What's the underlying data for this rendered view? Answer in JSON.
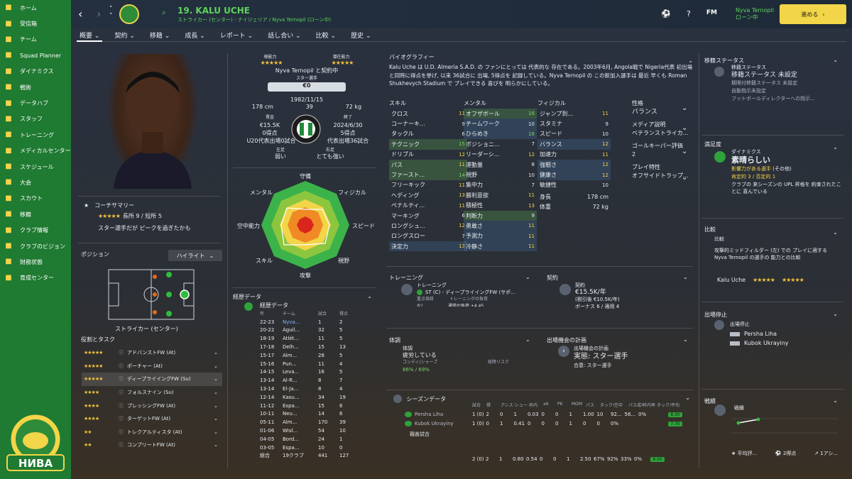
{
  "sidebar": {
    "items": [
      {
        "label": "ホーム",
        "icon": "home-icon"
      },
      {
        "label": "受信箱",
        "icon": "inbox-icon"
      },
      {
        "label": "チーム",
        "icon": "team-icon"
      },
      {
        "label": "Squad Planner",
        "icon": "planner-icon"
      },
      {
        "label": "ダイナミクス",
        "icon": "dynamics-icon"
      },
      {
        "label": "戦術",
        "icon": "tactics-icon"
      },
      {
        "label": "データハブ",
        "icon": "datahub-icon"
      },
      {
        "label": "スタッフ",
        "icon": "staff-icon"
      },
      {
        "label": "トレーニング",
        "icon": "training-icon"
      },
      {
        "label": "メディカルセンター",
        "icon": "medical-icon"
      },
      {
        "label": "スケジュール",
        "icon": "calendar-icon"
      },
      {
        "label": "大会",
        "icon": "trophy-icon"
      },
      {
        "label": "スカウト",
        "icon": "scout-icon"
      },
      {
        "label": "移籍",
        "icon": "transfer-icon"
      },
      {
        "label": "クラブ情報",
        "icon": "club-info-icon"
      },
      {
        "label": "クラブのビジョン",
        "icon": "vision-icon"
      },
      {
        "label": "財務状態",
        "icon": "finance-icon"
      },
      {
        "label": "育成センター",
        "icon": "development-icon"
      }
    ],
    "logo_text": "НИВА"
  },
  "topbar": {
    "player_name": "19. KALU UCHE",
    "subtitle": "ストライカー (センター) - ナイジェリア / Nyva Ternopil (ローン中)",
    "status_line1": "Nyva Ternopil",
    "status_line2": "ローン中",
    "fm_label": "FM",
    "continue_label": "進める"
  },
  "tabs": [
    "概要",
    "契約",
    "移籍",
    "成長",
    "レポート",
    "話し合い",
    "比較",
    "歴史"
  ],
  "overview": {
    "current_ability_label": "現能力",
    "potential_ability_label": "潜在能力",
    "contract_club": "Nyva Ternopil と契約中",
    "star_player": "スター選手",
    "value": "€0",
    "dob": "1982/11/15",
    "height": "178 cm",
    "age": "39",
    "weight": "72 kg",
    "wage_label": "賃金",
    "wage": "€15.5K",
    "expiry_label": "終了",
    "expiry": "2024/6/30",
    "goals_left": "0得点",
    "goals_right": "5得点",
    "u20": "U20代表出場0試合",
    "intl": "代表出場36試合",
    "left_foot_label": "左足",
    "left_foot": "弱い",
    "right_foot_label": "右足",
    "right_foot": "とても強い"
  },
  "coach_summary": {
    "title": "コーチサマリー",
    "strengths": "長所 9 / 短所 5",
    "note": "スター選手だが ピークを過ぎたかも"
  },
  "position": {
    "title": "ポジション",
    "dropdown": "ハイライト",
    "label": "ストライカー (センター)"
  },
  "roles": {
    "title": "役割とタスク",
    "items": [
      {
        "name": "アドバンストFW (At)",
        "stars": "★★★★★"
      },
      {
        "name": "ポーチャー (At)",
        "stars": "★★★★★"
      },
      {
        "name": "ディープライイングFW (Su)",
        "stars": "★★★★★"
      },
      {
        "name": "フォルスナイン (Su)",
        "stars": "★★★★"
      },
      {
        "name": "プレッシングFW (At)",
        "stars": "★★★★"
      },
      {
        "name": "ターゲットFW (At)",
        "stars": "★★★★"
      },
      {
        "name": "トレクアルティスタ (At)",
        "stars": "★★"
      },
      {
        "name": "コンプリートFW (At)",
        "stars": "★★"
      }
    ]
  },
  "radar": {
    "labels": [
      "守備",
      "フィジカル",
      "スピード",
      "視野",
      "攻撃",
      "スキル",
      "空中能力",
      "メンタル"
    ]
  },
  "career": {
    "title": "経歴データ",
    "sub": "経歴データ",
    "headers": [
      "年",
      "チーム",
      "試合",
      "得点"
    ],
    "rows": [
      [
        "22-23",
        "Nyva...",
        "1",
        "2"
      ],
      [
        "20-22",
        "Águil...",
        "32",
        "5"
      ],
      [
        "18-19",
        "Atlét...",
        "11",
        "5"
      ],
      [
        "17-18",
        "Delh...",
        "15",
        "13"
      ],
      [
        "15-17",
        "Alm...",
        "28",
        "5"
      ],
      [
        "15-16",
        "Pun...",
        "11",
        "4"
      ],
      [
        "14-15",
        "Leva...",
        "16",
        "5"
      ],
      [
        "13-14",
        "Al-R...",
        "8",
        "7"
      ],
      [
        "13-14",
        "El-Ja...",
        "8",
        "4"
      ],
      [
        "12-14",
        "Kasu...",
        "34",
        "19"
      ],
      [
        "11-12",
        "Espa...",
        "15",
        "6"
      ],
      [
        "10-11",
        "Neu...",
        "14",
        "6"
      ],
      [
        "05-11",
        "Alm...",
        "170",
        "39"
      ],
      [
        "01-06",
        "Wisł...",
        "54",
        "10"
      ],
      [
        "04-05",
        "Bord...",
        "24",
        "1"
      ],
      [
        "03-05",
        "Espa...",
        "10",
        "0"
      ]
    ],
    "total_label": "総合",
    "total_clubs": "19クラブ",
    "total_apps": "441",
    "total_goals": "127"
  },
  "bio": {
    "title": "バイオグラフィー",
    "text": "Kalu Uche は U.D. Almeria S.A.D. の ファンにとっては 代表的な 存在である。2003年6月, Angola戦で Nigeria代表 初出場と同時に得点を挙げ, 以来 36試合に 出場, 5得点を 記録している。Nyva Ternopil の この新加入選手は 最近 早くも Roman Shukhevych Stadium で プレイできる 喜びを 明らかにしている。"
  },
  "attributes": {
    "skills_title": "スキル",
    "mental_title": "メンタル",
    "physical_title": "フィジカル",
    "skills": [
      [
        "クロス",
        "11"
      ],
      [
        "コーナーキ...",
        "9"
      ],
      [
        "タックル",
        "6"
      ],
      [
        "テクニック",
        "15"
      ],
      [
        "ドリブル",
        "12"
      ],
      [
        "パス",
        "11"
      ],
      [
        "ファースト...",
        "14"
      ],
      [
        "フリーキック",
        "11"
      ],
      [
        "ヘディング",
        "13"
      ],
      [
        "ペナルティ...",
        "11"
      ],
      [
        "マーキング",
        "6"
      ],
      [
        "ロングシュ...",
        "12"
      ],
      [
        "ロングスロー",
        "7"
      ],
      [
        "決定力",
        "13"
      ]
    ],
    "mental": [
      [
        "オフザボール",
        "16"
      ],
      [
        "チームワーク",
        "10"
      ],
      [
        "ひらめき",
        "16"
      ],
      [
        "ポジショニ...",
        "7"
      ],
      [
        "リーダーシ...",
        "12"
      ],
      [
        "運動量",
        "8"
      ],
      [
        "視野",
        "10"
      ],
      [
        "集中力",
        "7"
      ],
      [
        "勝利意欲",
        "11"
      ],
      [
        "積極性",
        "13"
      ],
      [
        "判断力",
        "9"
      ],
      [
        "勇敢さ",
        "11"
      ],
      [
        "予測力",
        "11"
      ],
      [
        "冷静さ",
        "11"
      ]
    ],
    "physical": [
      [
        "ジャンプ到...",
        "11"
      ],
      [
        "スタミナ",
        "9"
      ],
      [
        "スピード",
        "10"
      ],
      [
        "バランス",
        "12"
      ],
      [
        "加速力",
        "11"
      ],
      [
        "強靭さ",
        "12"
      ],
      [
        "健康さ",
        "12"
      ],
      [
        "敏捷性",
        "10"
      ]
    ],
    "height_label": "身長",
    "height": "178 cm",
    "weight_label": "体重",
    "weight": "72 kg"
  },
  "personality": {
    "title": "性格",
    "value": "バランス",
    "media_title": "メディア説明",
    "media_value": "ベテランストライカ...",
    "gk_title": "ゴールキーパー評価",
    "gk_value": "2",
    "traits_title": "プレイ特性",
    "traits_value": "オフサイドトラップ..."
  },
  "training": {
    "title": "トレーニング",
    "sub": "トレーニング",
    "value": "ST (C) - ディープライイングFW (サポ...",
    "focus": "重点項目",
    "focus_value": "なし",
    "intensity": "トレーニングの負荷",
    "intensity_value": "通常の負荷 +4.45"
  },
  "contract": {
    "title": "契約",
    "sub": "契約",
    "wage": "€15.5K/年",
    "detail": "(税引後 €10.5K/年)",
    "bonus": "ボーナス 6 / 適用 4"
  },
  "condition": {
    "title": "体調",
    "sub": "体調",
    "value": "疲労している",
    "sharp_label": "コンディ/シャープ",
    "sharp_value": "86% / 69%",
    "injury": "故障リスク"
  },
  "plan": {
    "title": "出場機会の計画",
    "sub": "出場機会の計画",
    "value": "実態: スター選手",
    "agreed": "合意: スター選手"
  },
  "season": {
    "title": "シーズンデータ",
    "headers": [
      "試合",
      "得",
      "アシスト",
      "シュート",
      "枠内",
      "xA",
      "PK",
      "MOM",
      "パス",
      "タックル",
      "空中",
      "パス成功率",
      "枠内率",
      "タックル率",
      "平均"
    ],
    "rows": [
      {
        "team": "Persha Liha",
        "cells": [
          "1 (0)",
          "2",
          "0",
          "1",
          "0.03",
          "0",
          "0",
          "1",
          "1.00",
          "10",
          "92...",
          "56...",
          "0%",
          "",
          "8.30"
        ]
      },
      {
        "team": "Kubok Ukrayiny",
        "cells": [
          "1 (0)",
          "0",
          "1",
          "0.41",
          "0",
          "0",
          "0",
          "1",
          "0",
          "0",
          "0%",
          "",
          "",
          "",
          "7.70"
        ]
      }
    ],
    "friendly": "親善試合",
    "total": [
      "2 (0)",
      "2",
      "1",
      "0.80",
      "0.54",
      "0",
      "0",
      "1",
      "2.50",
      "67%",
      "92%",
      "33%",
      "0%",
      "8.00"
    ]
  },
  "transfer": {
    "title": "移籍ステータス",
    "sub": "移籍ステータス",
    "status": "移籍ステータス 未設定",
    "loan": "期限付移籍ステータス 未設定",
    "auto": "自動指示未設定",
    "df": "フットボールディレクターへの指示..."
  },
  "satisfaction": {
    "title": "満足度",
    "dyn_label": "ダイナミクス",
    "dyn_value": "素晴らしい",
    "influence": "影響力がある選手",
    "influence_note": "(その他)",
    "pos_neg": "肯定的 3 / 否定的 1",
    "note": "クラブの 来シーズンの UPL 昇格を 約束されたことに 喜んでいる"
  },
  "compare": {
    "title": "比較",
    "sub": "比較",
    "text": "攻撃的ミッドフィルダー (左) での プレイに適する Nyva Ternopil の選手の 能力との比較",
    "player": "Kalu Uche"
  },
  "suspension": {
    "title": "出場停止",
    "sub": "出場停止",
    "items": [
      "Persha Liha",
      "Kubok Ukrayiny"
    ]
  },
  "form": {
    "title": "戦績",
    "sub": "戦績",
    "avg": "平均評...",
    "goals": "2得点",
    "assists": "1アシ..."
  }
}
